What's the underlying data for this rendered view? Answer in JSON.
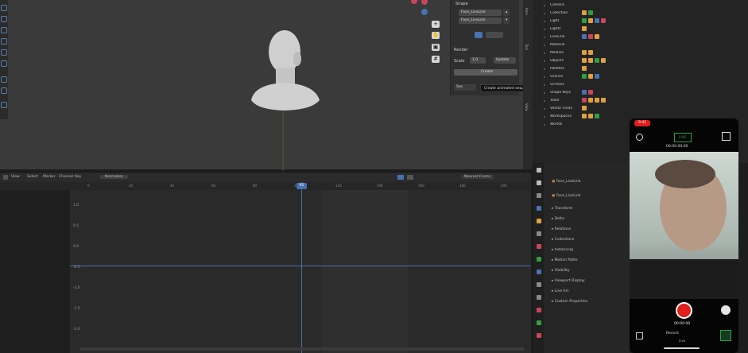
{
  "npanel": {
    "section1": "Shape",
    "slot1": "Face_LiveLink",
    "slot2": "Face_LiveLink",
    "section2": "Render",
    "field_label": "Scale",
    "field_value": "1.0",
    "btn_right": "Update",
    "btn_main": "Create",
    "btn_bottom": "Sav"
  },
  "tooltip": "Create animated sequence",
  "outliner": {
    "items": [
      {
        "name": "Camera"
      },
      {
        "name": "Collection"
      },
      {
        "name": "Light"
      },
      {
        "name": "Lights"
      },
      {
        "name": "LiveLink"
      },
      {
        "name": "Material"
      },
      {
        "name": "Meshes"
      },
      {
        "name": "Objects"
      },
      {
        "name": "Palettes"
      },
      {
        "name": "Scenes"
      },
      {
        "name": "Screens"
      },
      {
        "name": "Shape Keys"
      },
      {
        "name": "Texts"
      },
      {
        "name": "Vector Fonts"
      },
      {
        "name": "Workspaces"
      },
      {
        "name": "Worlds"
      }
    ]
  },
  "timeline": {
    "menus": [
      "View",
      "Select",
      "Marker",
      "Channel",
      "Key"
    ],
    "mode": "Normalize",
    "pivot": "Nearest Frame",
    "frames": [
      "0",
      "20",
      "40",
      "60",
      "80",
      "100",
      "120",
      "140",
      "160",
      "180",
      "200",
      "220"
    ],
    "current_frame": "92",
    "y_labels": [
      "1.0",
      "0.5",
      "0.0",
      "-0.5",
      "-1.0",
      "-1.5",
      "-2.0"
    ]
  },
  "properties": {
    "header1": "Face_LiveLink",
    "header2": "Face_LiveLink",
    "rows": [
      "Transform",
      "Delta",
      "Relations",
      "Collections",
      "Instancing",
      "Motion Paths",
      "Visibility",
      "Viewport Display",
      "Line Art",
      "Custom Properties"
    ]
  },
  "phone": {
    "status": "9:41",
    "rec_timer": "00:00:00",
    "timecode": "00:00:00:00",
    "bottom_label": "Record",
    "bottom_sub": "Live",
    "top_badge": "LIVE"
  },
  "colors": {
    "accent_blue": "#4772b3",
    "record_red": "#e11d1d",
    "green": "#2f9e44"
  }
}
